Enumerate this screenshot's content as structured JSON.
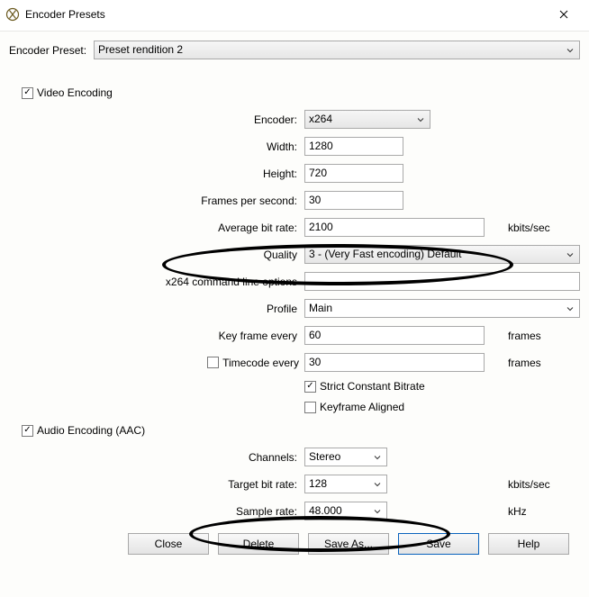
{
  "title": "Encoder Presets",
  "preset_label": "Encoder Preset:",
  "preset_value": "Preset rendition 2",
  "video": {
    "section_label": "Video Encoding",
    "checked": true,
    "encoder_label": "Encoder:",
    "encoder_value": "x264",
    "width_label": "Width:",
    "width_value": "1280",
    "height_label": "Height:",
    "height_value": "720",
    "fps_label": "Frames per second:",
    "fps_value": "30",
    "avg_bitrate_label": "Average bit rate:",
    "avg_bitrate_value": "2100",
    "avg_bitrate_unit": "kbits/sec",
    "quality_label": "Quality",
    "quality_value": "3 - (Very Fast encoding) Default",
    "cmdline_label": "x264 command line options",
    "cmdline_value": "",
    "profile_label": "Profile",
    "profile_value": "Main",
    "keyframe_label": "Key frame every",
    "keyframe_value": "60",
    "keyframe_unit": "frames",
    "timecode_label": "Timecode every",
    "timecode_checked": false,
    "timecode_value": "30",
    "timecode_unit": "frames",
    "strict_cbr_label": "Strict Constant Bitrate",
    "strict_cbr_checked": true,
    "keyframe_aligned_label": "Keyframe Aligned",
    "keyframe_aligned_checked": false
  },
  "audio": {
    "section_label": "Audio Encoding (AAC)",
    "checked": true,
    "channels_label": "Channels:",
    "channels_value": "Stereo",
    "target_bitrate_label": "Target bit rate:",
    "target_bitrate_value": "128",
    "target_bitrate_unit": "kbits/sec",
    "sample_rate_label": "Sample rate:",
    "sample_rate_value": "48.000",
    "sample_rate_unit": "kHz"
  },
  "buttons": {
    "close": "Close",
    "delete": "Delete",
    "save_as": "Save As...",
    "save": "Save",
    "help": "Help"
  }
}
